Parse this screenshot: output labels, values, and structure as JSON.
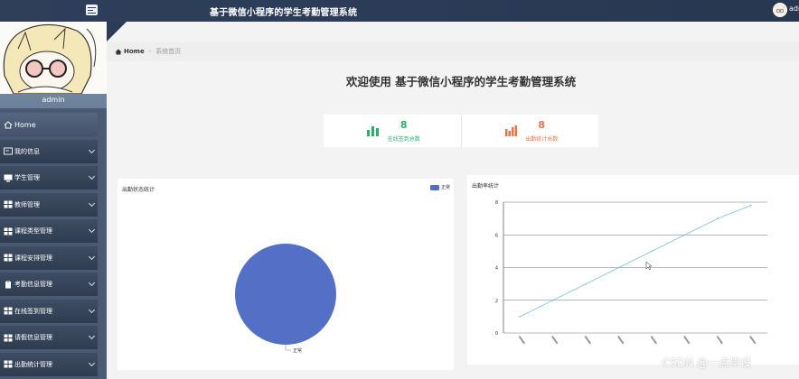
{
  "header": {
    "title": "基于微信小程序的学生考勤管理系统",
    "user": "admin"
  },
  "sidebar": {
    "profile_name": "admin",
    "items": [
      {
        "label": "Home",
        "icon": "home-icon",
        "active": true
      },
      {
        "label": "我的信息",
        "icon": "id-card-icon"
      },
      {
        "label": "学生管理",
        "icon": "monitor-icon"
      },
      {
        "label": "教师管理",
        "icon": "grid-icon"
      },
      {
        "label": "课程类型管理",
        "icon": "grid-icon"
      },
      {
        "label": "课程安排管理",
        "icon": "grid-icon"
      },
      {
        "label": "考勤信息管理",
        "icon": "clipboard-icon"
      },
      {
        "label": "在线签到管理",
        "icon": "grid-icon"
      },
      {
        "label": "请假信息管理",
        "icon": "grid-icon"
      },
      {
        "label": "出勤统计管理",
        "icon": "grid-icon"
      }
    ]
  },
  "breadcrumb": {
    "home": "Home",
    "current": "系统首页"
  },
  "welcome": "欢迎使用 基于微信小程序的学生考勤管理系统",
  "stats": [
    {
      "value": "8",
      "label": "在线签到总数",
      "color": "#29b06a",
      "icon": "bar-chart-icon"
    },
    {
      "value": "8",
      "label": "出勤统计总数",
      "color": "#e4754a",
      "icon": "bar-chart-icon"
    }
  ],
  "colors": {
    "pie": "#5470c6",
    "line": "#7ec5dd",
    "topbar": "#2b3c58"
  },
  "chart_data": [
    {
      "type": "pie",
      "title": "出勤状态统计",
      "slices": [
        {
          "name": "正常",
          "value": 100
        }
      ],
      "legend": "top-right"
    },
    {
      "type": "line",
      "title": "出勤率统计",
      "ylim": [
        0,
        8
      ],
      "yticks": [
        "0",
        "2",
        "4",
        "6",
        "8"
      ],
      "categories": [
        "",
        "",
        "",
        "",
        "",
        "",
        "",
        ""
      ],
      "x_labels_rotated": true,
      "series": [
        {
          "values": [
            1,
            2,
            3,
            4,
            5,
            6,
            7,
            7.8
          ]
        }
      ]
    }
  ],
  "watermark": "CSDN @一点毕设"
}
